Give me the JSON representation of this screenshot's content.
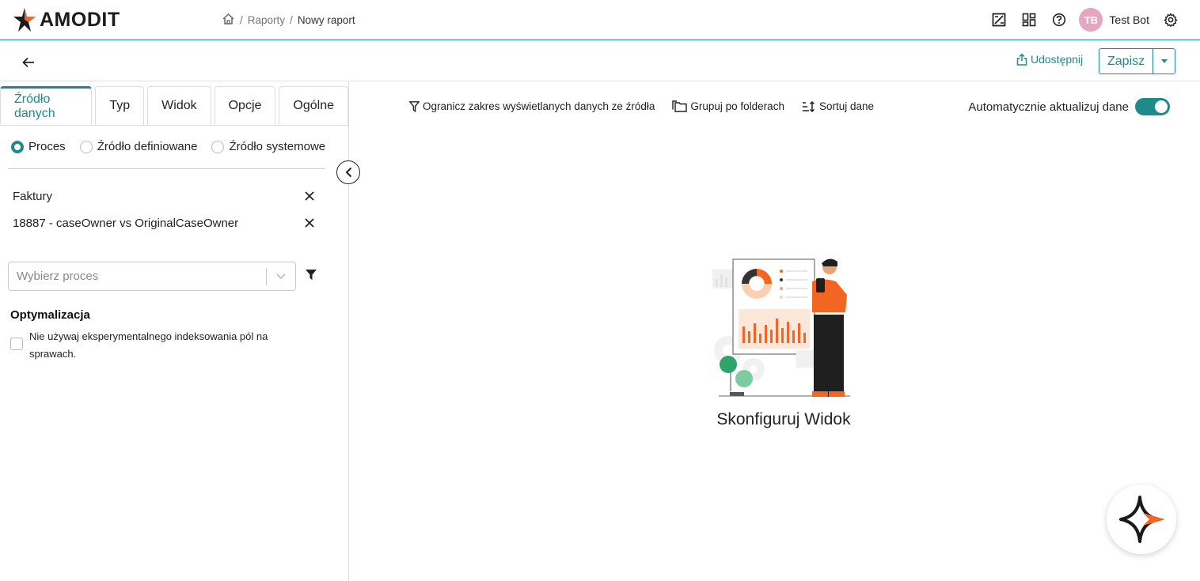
{
  "app": {
    "name": "AMODIT"
  },
  "breadcrumb": {
    "items": [
      "Raporty",
      "Nowy raport"
    ],
    "separator": "/"
  },
  "user": {
    "initials": "TB",
    "name": "Test Bot"
  },
  "actions": {
    "share_label": "Udostępnij",
    "save_label": "Zapisz"
  },
  "tabs": [
    {
      "label": "Źródło danych",
      "active": true
    },
    {
      "label": "Typ",
      "active": false
    },
    {
      "label": "Widok",
      "active": false
    },
    {
      "label": "Opcje",
      "active": false
    },
    {
      "label": "Ogólne",
      "active": false
    }
  ],
  "source_options": [
    {
      "label": "Proces",
      "checked": true
    },
    {
      "label": "Źródło definiowane",
      "checked": false
    },
    {
      "label": "Źródło systemowe",
      "checked": false
    }
  ],
  "selected_items": [
    "Faktury",
    "18887 - caseOwner vs OriginalCaseOwner"
  ],
  "process_select": {
    "placeholder": "Wybierz proces"
  },
  "optimization": {
    "title": "Optymalizacja",
    "checkbox_label": "Nie używaj eksperymentalnego indeksowania pól na sprawach.",
    "checked": false
  },
  "toolbar": {
    "filter_label": "Ogranicz zakres wyświetlanych danych ze źródła",
    "group_label": "Grupuj po folderach",
    "sort_label": "Sortuj dane"
  },
  "auto_update": {
    "label": "Automatycznie aktualizuj dane",
    "enabled": true
  },
  "empty_state": {
    "title": "Skonfiguruj Widok"
  },
  "colors": {
    "accent": "#1f8a8a",
    "brand_orange": "#f26522",
    "avatar": "#e3a8c0"
  }
}
